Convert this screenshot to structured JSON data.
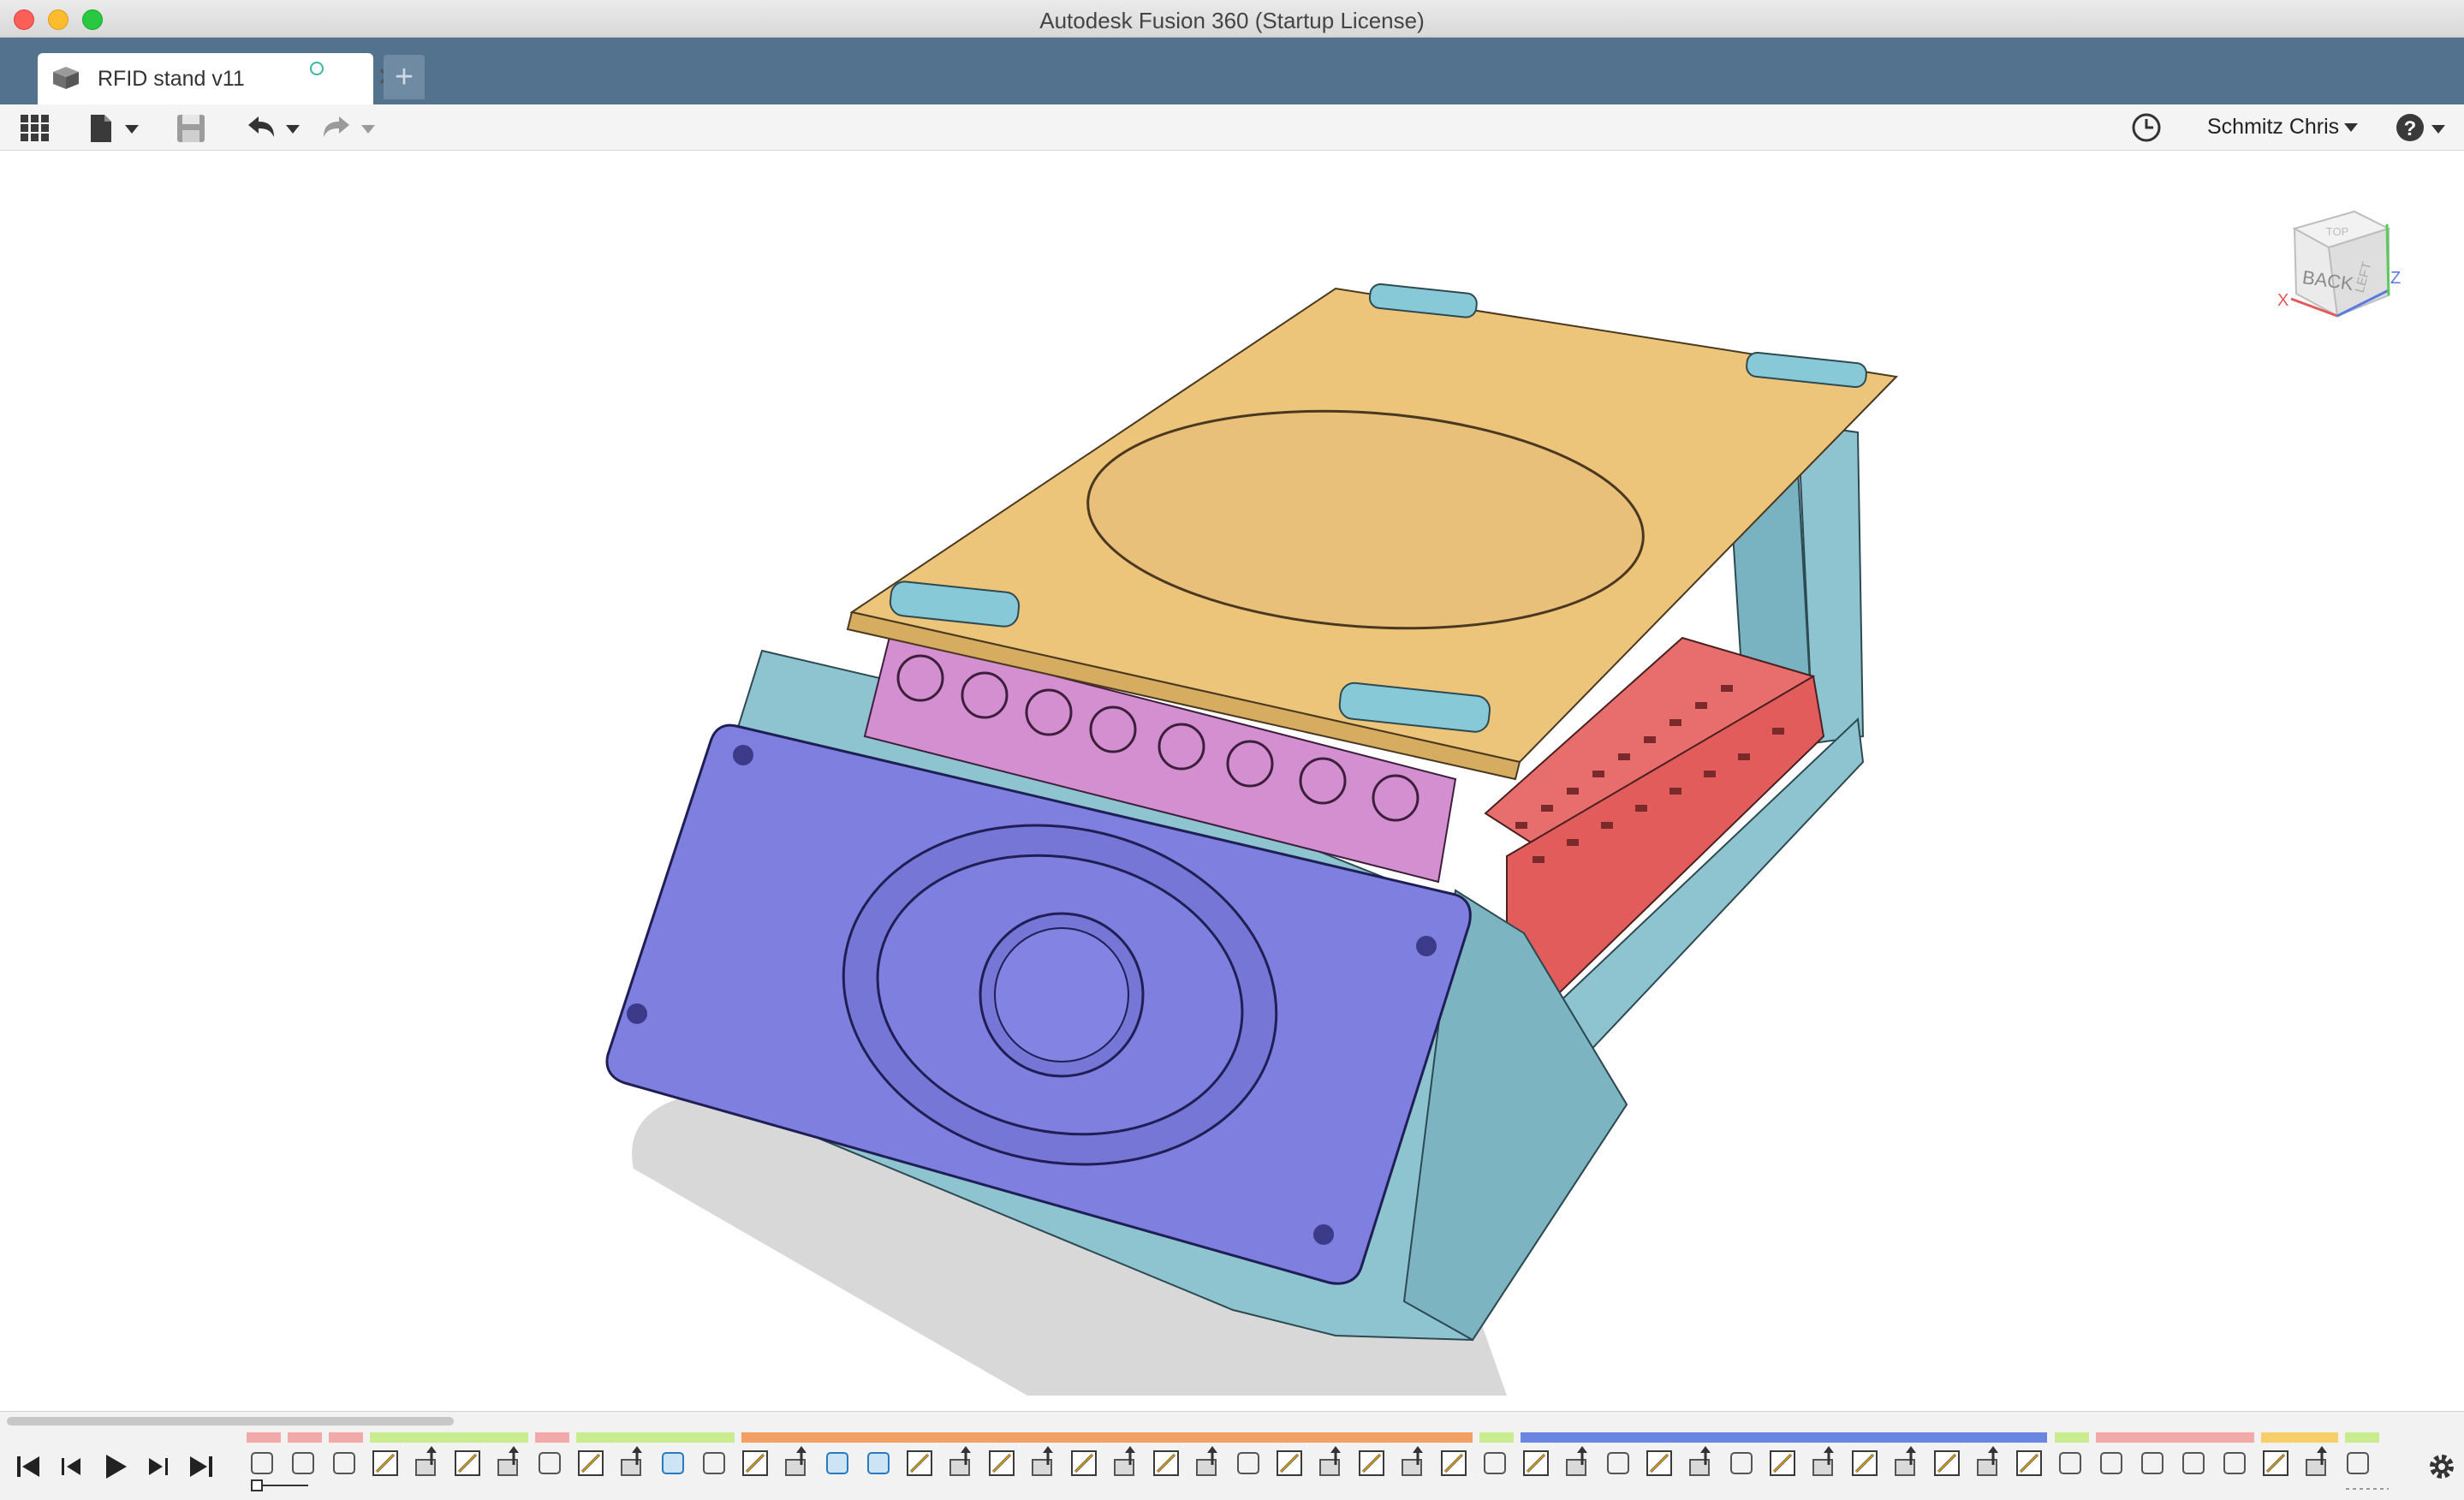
{
  "window": {
    "title": "Autodesk Fusion 360 (Startup License)"
  },
  "tabs": [
    {
      "label": "RFID stand v11"
    }
  ],
  "toolbar": {
    "user_name": "Schmitz Chris"
  },
  "viewcube": {
    "face_front": "BACK",
    "face_top": "TOP",
    "face_right": "LEFT",
    "axis_x": "X",
    "axis_z": "Z"
  },
  "icons": [
    "data-panel-grid-icon",
    "file-icon",
    "save-icon",
    "undo-icon",
    "redo-icon",
    "job-status-clock-icon",
    "help-icon",
    "settings-gear-icon"
  ],
  "colors": {
    "tabbar": "#52728e",
    "plate_yellow": "#edc57a",
    "buttons_pink": "#d48fd0",
    "speaker_purple": "#7f7fe0",
    "housing_teal": "#8ec4d0",
    "board_red": "#e86e6e",
    "foot_blue": "#88c9d8"
  }
}
